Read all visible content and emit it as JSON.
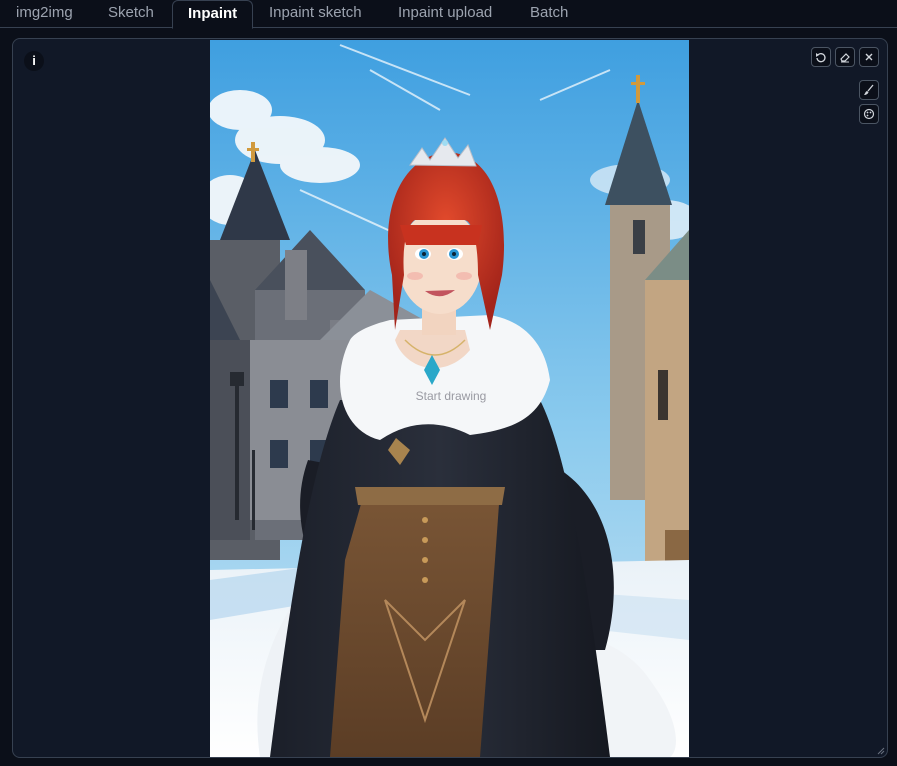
{
  "tabs": [
    {
      "label": "img2img",
      "active": false
    },
    {
      "label": "Sketch",
      "active": false
    },
    {
      "label": "Inpaint",
      "active": true
    },
    {
      "label": "Inpaint sketch",
      "active": false
    },
    {
      "label": "Inpaint upload",
      "active": false
    },
    {
      "label": "Batch",
      "active": false
    }
  ],
  "canvas": {
    "info_label": "i",
    "placeholder": "Start drawing",
    "image_subject": "anime-girl-red-hair-tiara-fur-cape-snowy-castle-town",
    "toolbar": {
      "undo_icon": "undo-icon",
      "clear_icon": "eraser-icon",
      "close_icon": "close-icon",
      "brush_icon": "brush-icon",
      "color_icon": "palette-icon"
    }
  },
  "colors": {
    "background": "#0b0f19",
    "panel": "#111827",
    "border": "#374151",
    "active_tab_text": "#ffffff",
    "tab_text": "#9ca3af"
  }
}
